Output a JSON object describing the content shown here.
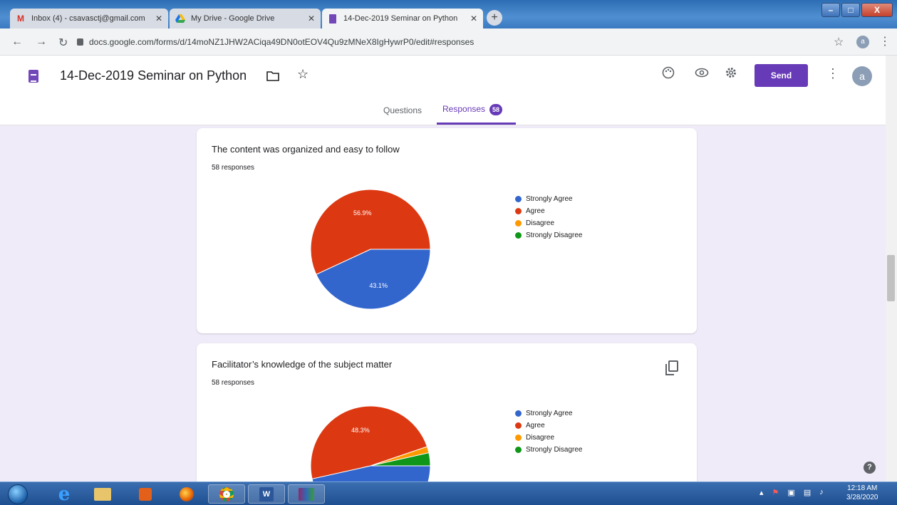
{
  "browser": {
    "tabs": [
      {
        "label": "Inbox (4) - csavasctj@gmail.com",
        "icon": "gmail-icon"
      },
      {
        "label": "My Drive - Google Drive",
        "icon": "drive-icon"
      },
      {
        "label": "14-Dec-2019 Seminar on Python",
        "icon": "forms-icon"
      }
    ],
    "new_tab": "+",
    "url": "docs.google.com/forms/d/14moNZ1JHW2ACiqa49DN0otEOV4Qu9zMNeX8IgHywrP0/edit#responses",
    "profile_initial": "a"
  },
  "form": {
    "title": "14-Dec-2019 Seminar on Python",
    "send_label": "Send",
    "avatar_initial": "a",
    "tabs": {
      "questions": "Questions",
      "responses": "Responses",
      "responses_count": "58"
    }
  },
  "questions": [
    {
      "title": "The content was organized and easy to follow",
      "count": "58 responses",
      "legend": [
        "Strongly Agree",
        "Agree",
        "Disagree",
        "Strongly Disagree"
      ],
      "labels": [
        "43.1%",
        "56.9%"
      ]
    },
    {
      "title": "Facilitator’s knowledge of the subject matter",
      "count": "58 responses",
      "legend": [
        "Strongly Agree",
        "Agree",
        "Disagree",
        "Strongly Disagree"
      ],
      "labels": [
        "48.3%"
      ]
    }
  ],
  "chart_data": [
    {
      "type": "pie",
      "categories": [
        "Strongly Agree",
        "Agree",
        "Disagree",
        "Strongly Disagree"
      ],
      "values": [
        43.1,
        56.9,
        0,
        0
      ],
      "colors": [
        "#3366cc",
        "#dc3912",
        "#ff9900",
        "#109618"
      ]
    },
    {
      "type": "pie",
      "categories": [
        "Strongly Agree",
        "Agree",
        "Disagree",
        "Strongly Disagree"
      ],
      "values": [
        46.5,
        48.3,
        1.7,
        3.5
      ],
      "colors": [
        "#3366cc",
        "#dc3912",
        "#ff9900",
        "#109618"
      ]
    }
  ],
  "help_label": "?",
  "taskbar": {
    "clock_time": "12:18 AM",
    "clock_date": "3/28/2020"
  }
}
